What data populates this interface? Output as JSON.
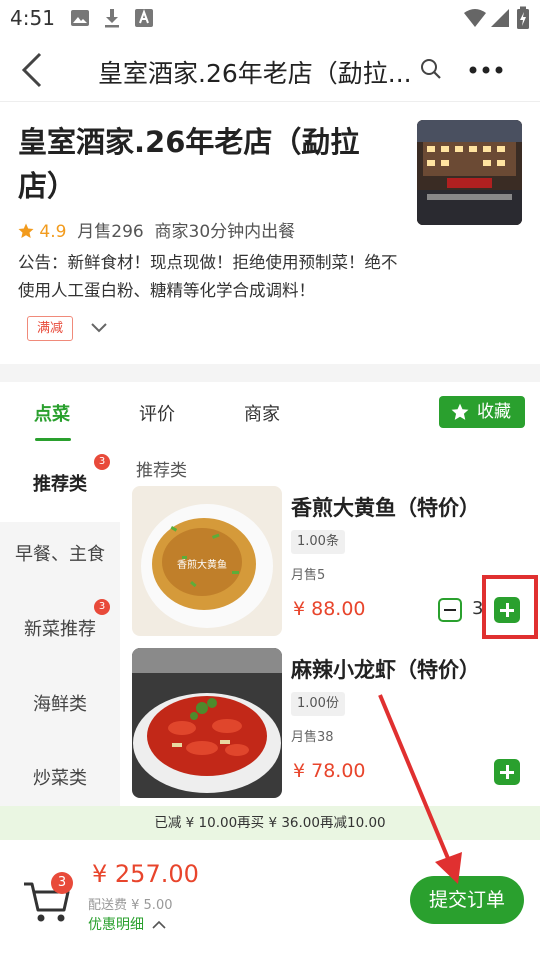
{
  "status_bar": {
    "time": "4:51"
  },
  "nav": {
    "title": "皇室酒家.26年老店（勐拉..."
  },
  "shop": {
    "name": "皇室酒家.26年老店（勐拉店）",
    "rating": "4.9",
    "monthly_sales": "月售296",
    "delivery_time": "商家30分钟内出餐",
    "notice": "公告：新鲜食材！现点现做！拒绝使用预制菜！绝不使用人工蛋白粉、糖精等化学合成调料！",
    "tag": "满减"
  },
  "tabs": [
    {
      "label": "点菜"
    },
    {
      "label": "评价"
    },
    {
      "label": "商家"
    }
  ],
  "favorite_label": "收藏",
  "categories": [
    {
      "label": "推荐类",
      "badge": "3"
    },
    {
      "label": "早餐、主食"
    },
    {
      "label": "新菜推荐",
      "badge": "3"
    },
    {
      "label": "海鲜类"
    },
    {
      "label": "炒菜类"
    }
  ],
  "section_title": "推荐类",
  "dishes": [
    {
      "name": "香煎大黄鱼（特价）",
      "spec": "1.00条",
      "sold": "月售5",
      "price": "¥ 88.00",
      "qty": "3",
      "image_caption": "香煎大黄鱼"
    },
    {
      "name": "麻辣小龙虾（特价）",
      "spec": "1.00份",
      "sold": "月售38",
      "price": "¥ 78.00"
    }
  ],
  "discount_text": "已减 ¥ 10.00再买 ¥ 36.00再减10.00",
  "cart": {
    "count": "3",
    "total": "¥ 257.00",
    "delivery_fee": "配送费 ¥ 5.00",
    "promo_detail": "优惠明细",
    "submit": "提交订单"
  },
  "colors": {
    "accent": "#2aa02e",
    "price": "#e8452c",
    "badge": "#e84a3a",
    "rating": "#f29b1d"
  }
}
